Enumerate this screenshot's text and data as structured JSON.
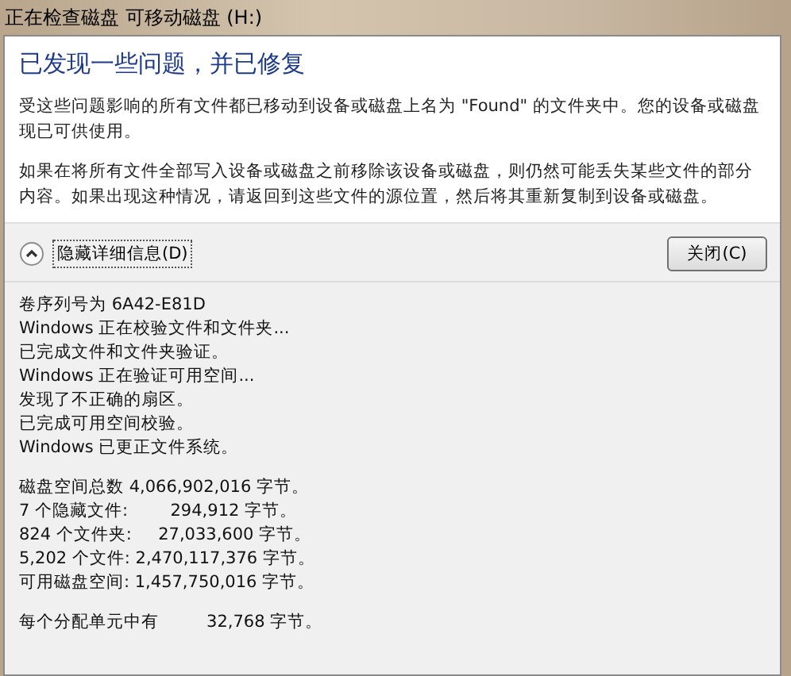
{
  "window": {
    "title": "正在检查磁盘 可移动磁盘 (H:)"
  },
  "heading": "已发现一些问题，并已修复",
  "paragraphs": [
    "受这些问题影响的所有文件都已移动到设备或磁盘上名为 \"Found\" 的文件夹中。您的设备或磁盘现已可供使用。",
    "如果在将所有文件全部写入设备或磁盘之前移除该设备或磁盘，则仍然可能丢失某些文件的部分内容。如果出现这种情况，请返回到这些文件的源位置，然后将其重新复制到设备或磁盘。"
  ],
  "details_toggle": {
    "label": "隐藏详细信息(D)",
    "expanded": true
  },
  "close_button": "关闭(C)",
  "log_groups": [
    [
      "卷序列号为 6A42-E81D",
      "Windows 正在校验文件和文件夹...",
      "已完成文件和文件夹验证。",
      "Windows 正在验证可用空间...",
      "发现了不正确的扇区。",
      "已完成可用空间校验。",
      "Windows 已更正文件系统。"
    ],
    [
      "磁盘空间总数 4,066,902,016 字节。",
      "7 个隐藏文件:        294,912 字节。",
      "824 个文件夹:     27,033,600 字节。",
      "5,202 个文件: 2,470,117,376 字节。",
      "可用磁盘空间: 1,457,750,016 字节。"
    ],
    [
      "每个分配单元中有         32,768 字节。"
    ]
  ]
}
